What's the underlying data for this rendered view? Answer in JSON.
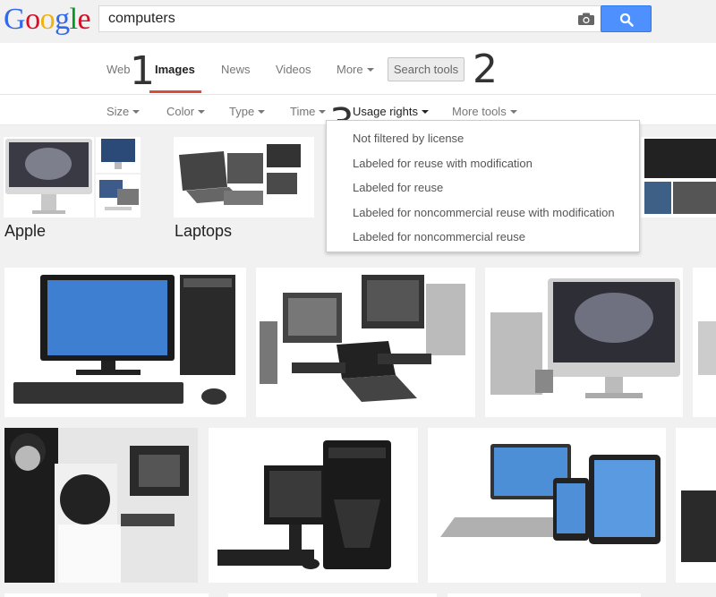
{
  "logo": {
    "letters": [
      "G",
      "o",
      "o",
      "g",
      "l",
      "e"
    ],
    "colors": [
      "#3369e8",
      "#d50f25",
      "#eeb211",
      "#3369e8",
      "#009925",
      "#d50f25"
    ]
  },
  "search": {
    "query": "computers"
  },
  "nav": {
    "tabs": [
      "Web",
      "Images",
      "News",
      "Videos"
    ],
    "more_label": "More",
    "search_tools_label": "Search tools"
  },
  "annotations": {
    "one": "1",
    "two": "2",
    "three": "3"
  },
  "tools": {
    "items": [
      "Size",
      "Color",
      "Type",
      "Time",
      "Usage rights",
      "More tools"
    ]
  },
  "usage_menu": {
    "items": [
      "Not filtered by license",
      "Labeled for reuse with modification",
      "Labeled for reuse",
      "Labeled for noncommercial reuse with modification",
      "Labeled for noncommercial reuse"
    ]
  },
  "related": {
    "labels": [
      "Apple",
      "Laptops"
    ]
  },
  "colors": {
    "accent_blue": "#4d90fe",
    "tab_red": "#dd4b39"
  }
}
